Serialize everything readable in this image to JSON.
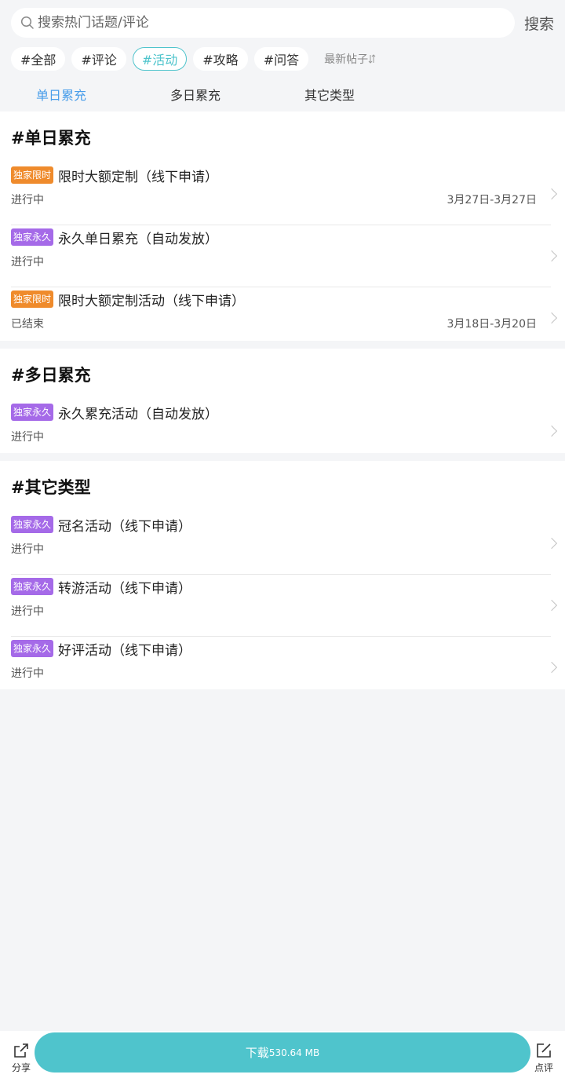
{
  "search": {
    "placeholder": "搜索热门话题/评论",
    "button": "搜索"
  },
  "tags": [
    {
      "label": "#全部",
      "active": false
    },
    {
      "label": "#评论",
      "active": false
    },
    {
      "label": "#活动",
      "active": true
    },
    {
      "label": "#攻略",
      "active": false
    },
    {
      "label": "#问答",
      "active": false
    }
  ],
  "sort": {
    "label": "最新帖子"
  },
  "subtabs": [
    {
      "label": "单日累充",
      "active": true
    },
    {
      "label": "多日累充",
      "active": false
    },
    {
      "label": "其它类型",
      "active": false
    }
  ],
  "sections": [
    {
      "title": "#单日累充",
      "items": [
        {
          "badge": "独家限时",
          "badge_type": "limited",
          "title": "限时大额定制（线下申请）",
          "status": "进行中",
          "date": "3月27日-3月27日"
        },
        {
          "badge": "独家永久",
          "badge_type": "permanent",
          "title": "永久单日累充（自动发放）",
          "status": "进行中",
          "date": ""
        },
        {
          "badge": "独家限时",
          "badge_type": "limited",
          "title": "限时大额定制活动（线下申请）",
          "status": "已结束",
          "date": "3月18日-3月20日"
        }
      ]
    },
    {
      "title": "#多日累充",
      "items": [
        {
          "badge": "独家永久",
          "badge_type": "permanent",
          "title": "永久累充活动（自动发放）",
          "status": "进行中",
          "date": ""
        }
      ]
    },
    {
      "title": "#其它类型",
      "items": [
        {
          "badge": "独家永久",
          "badge_type": "permanent",
          "title": "冠名活动（线下申请）",
          "status": "进行中",
          "date": ""
        },
        {
          "badge": "独家永久",
          "badge_type": "permanent",
          "title": "转游活动（线下申请）",
          "status": "进行中",
          "date": ""
        },
        {
          "badge": "独家永久",
          "badge_type": "permanent",
          "title": "好评活动（线下申请）",
          "status": "进行中",
          "date": ""
        }
      ]
    }
  ],
  "bottom": {
    "share_label": "分享",
    "download_label": "下载",
    "download_size": "530.64 MB",
    "review_label": "点评"
  },
  "colors": {
    "accent": "#4fc4cc",
    "tab_active": "#4a9eea",
    "badge_limited": "#ef8b2c",
    "badge_permanent": "#a56ae8",
    "background": "#f4f5f7"
  }
}
